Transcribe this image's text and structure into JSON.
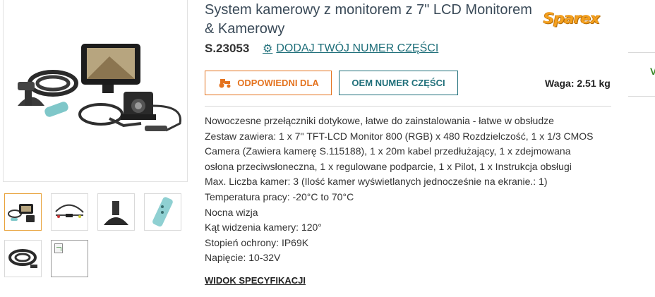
{
  "product": {
    "title": "System kamerowy z monitorem z 7\" LCD Monitorem & Kamerowy",
    "sku": "S.23053",
    "add_part_label": "DODAJ TWÓJ NUMER CZĘŚCI",
    "brand_logo": "Sparex",
    "weight": "Waga: 2.51 kg"
  },
  "buttons": {
    "fits_label": "ODPOWIEDNI DLA",
    "oem_label": "OEM NUMER CZĘŚCI"
  },
  "description": [
    "Nowoczesne przełączniki dotykowe, łatwe do zainstalowania - łatwe w obsłudze",
    "Zestaw zawiera: 1 x 7'' TFT-LCD Monitor 800 (RGB) x 480 Rozdzielczość, 1 x 1/3 CMOS",
    "Camera (Zawiera kamerę S.115188), 1 x 20m kabel przedłużający, 1 x zdejmowana",
    "osłona przeciwsłoneczna, 1 x regulowane podparcie, 1 x Pilot, 1 x Instrukcja obsługi",
    "Max. Liczba kamer: 3 (Ilość kamer wyświetlanych jednocześnie na ekranie.: 1)",
    "Temperatura pracy: -20°C to 70°C",
    "Nocna wizja",
    "Kąt widzenia kamery: 120°",
    "Stopień ochrony: IP69K",
    "Napięcie: 10-32V"
  ],
  "spec_link": "WIDOK SPECYFIKACJI",
  "side_fragment": "V",
  "icons": {
    "gear": "gear-icon",
    "tractor": "tractor-icon",
    "broken_image": "broken-image-icon"
  },
  "colors": {
    "accent_orange": "#e4731f",
    "accent_teal": "#1f6f7a",
    "logo_orange": "#f4a01e",
    "title_color": "#3a4a58"
  }
}
